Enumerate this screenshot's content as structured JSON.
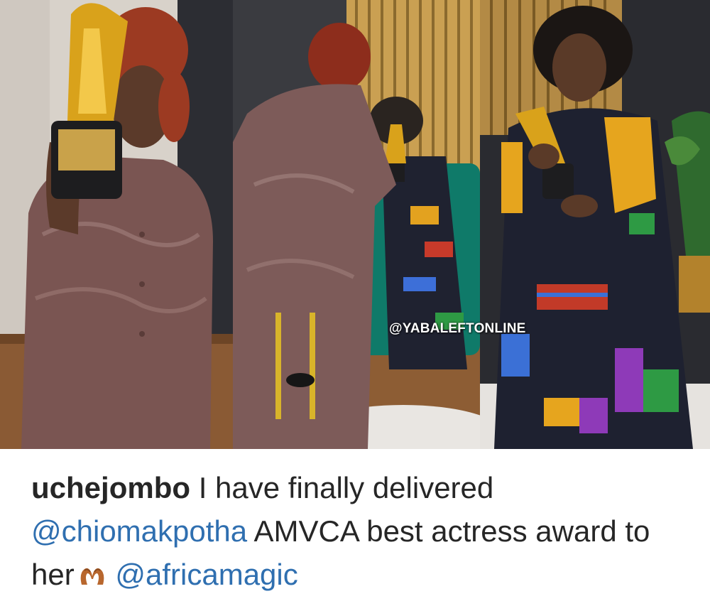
{
  "post": {
    "watermark": "@YABALEFTONLINE",
    "caption": {
      "username": "uchejombo",
      "text_1": "I have finally delivered",
      "mention_1": "@chiomakpotha",
      "text_2": "AMVCA best actress award to her",
      "emoji": "heart-hands-icon",
      "mention_2": "@africamagic"
    },
    "colors": {
      "text": "#262626",
      "mention": "#2f6fb0",
      "trophy_gold": "#d9a21b"
    }
  }
}
